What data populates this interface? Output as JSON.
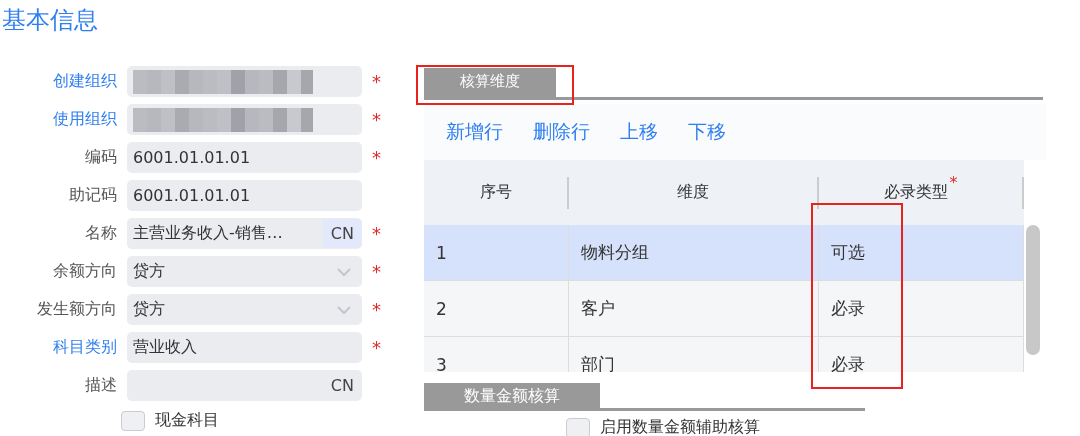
{
  "title": "基本信息",
  "fields": [
    {
      "label": "创建组织",
      "link": true,
      "kind": "redacted",
      "required_mark": "*"
    },
    {
      "label": "使用组织",
      "link": true,
      "kind": "redacted",
      "required_mark": "*"
    },
    {
      "label": "编码",
      "link": false,
      "kind": "text",
      "value": "6001.01.01.01",
      "required_mark": "*"
    },
    {
      "label": "助记码",
      "link": false,
      "kind": "text",
      "value": "6001.01.01.01"
    },
    {
      "label": "名称",
      "link": false,
      "kind": "lang",
      "value": "主营业务收入-销售…",
      "lang": "CN",
      "required_mark": "*"
    },
    {
      "label": "余额方向",
      "link": false,
      "kind": "select",
      "value": "贷方",
      "required_mark": "*"
    },
    {
      "label": "发生额方向",
      "link": false,
      "kind": "select",
      "value": "贷方",
      "required_mark": "*"
    },
    {
      "label": "科目类别",
      "link": true,
      "kind": "text",
      "value": "营业收入",
      "required_mark": "*"
    },
    {
      "label": "描述",
      "link": false,
      "kind": "lang",
      "lang": "CN"
    }
  ],
  "cash_checkbox": {
    "label": "现金科目",
    "checked": false
  },
  "dimension_section": {
    "title": "核算维度",
    "highlighted": true,
    "toolbar": [
      "新增行",
      "删除行",
      "上移",
      "下移"
    ],
    "columns": [
      {
        "label": "序号",
        "highlighted": false
      },
      {
        "label": "维度",
        "highlighted": false
      },
      {
        "label": "必录类型",
        "required_mark": "*",
        "highlighted": true
      }
    ],
    "rows": [
      {
        "cells": [
          "1",
          "物料分组",
          "可选"
        ],
        "selected": true
      },
      {
        "cells": [
          "2",
          "客户",
          "必录"
        ],
        "selected": false
      },
      {
        "cells": [
          "3",
          "部门",
          "必录"
        ],
        "selected": false
      }
    ]
  },
  "quantity_section": {
    "title": "数量金额核算",
    "checkbox": {
      "label": "启用数量金额辅助核算",
      "checked": false
    }
  }
}
